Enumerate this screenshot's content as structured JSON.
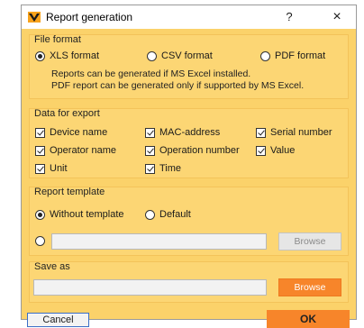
{
  "window": {
    "title": "Report generation",
    "help_label": "?",
    "close_label": "×"
  },
  "file_format": {
    "title": "File format",
    "options": [
      {
        "label": "XLS format",
        "selected": true
      },
      {
        "label": "CSV format",
        "selected": false
      },
      {
        "label": "PDF format",
        "selected": false
      }
    ],
    "note_line1": "Reports can be generated if MS Excel installed.",
    "note_line2": "PDF report can be generated only if supported by MS Excel."
  },
  "data_for_export": {
    "title": "Data for export",
    "items": [
      {
        "label": "Device name",
        "checked": true
      },
      {
        "label": "MAC-address",
        "checked": true
      },
      {
        "label": "Serial number",
        "checked": true
      },
      {
        "label": "Operator name",
        "checked": true
      },
      {
        "label": "Operation number",
        "checked": true
      },
      {
        "label": "Value",
        "checked": true
      },
      {
        "label": "Unit",
        "checked": true
      },
      {
        "label": "Time",
        "checked": true
      }
    ]
  },
  "report_template": {
    "title": "Report template",
    "options": [
      {
        "label": "Without template",
        "selected": true
      },
      {
        "label": "Default",
        "selected": false
      }
    ],
    "path_value": "",
    "browse_label": "Browse"
  },
  "save_as": {
    "title": "Save as",
    "path_value": "",
    "browse_label": "Browse"
  },
  "footer": {
    "cancel_label": "Cancel",
    "ok_label": "OK"
  },
  "colors": {
    "background": "#fbd26a",
    "accent": "#f7852a"
  }
}
